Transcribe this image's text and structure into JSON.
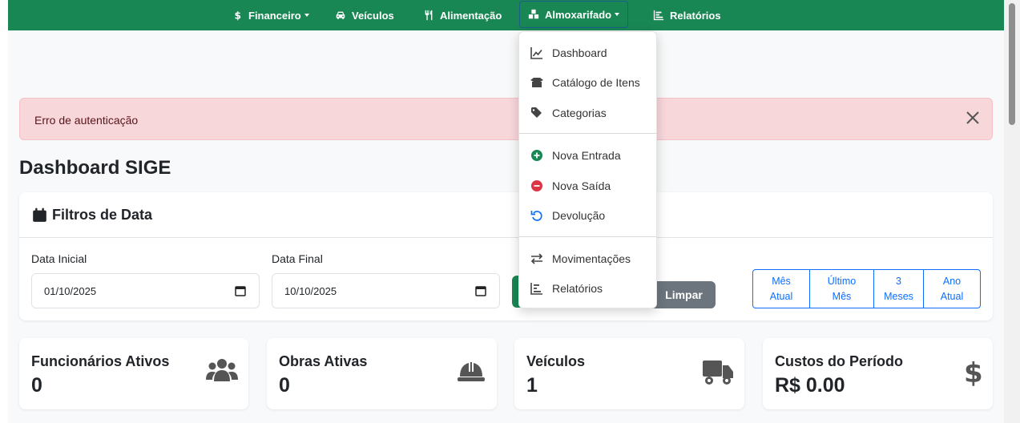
{
  "navbar": {
    "items": [
      {
        "label": "Financeiro",
        "icon": "dollar-icon",
        "dropdown": true
      },
      {
        "label": "Veículos",
        "icon": "car-icon",
        "dropdown": false
      },
      {
        "label": "Alimentação",
        "icon": "utensils-icon",
        "dropdown": false
      },
      {
        "label": "Almoxarifado",
        "icon": "boxes-icon",
        "dropdown": true
      },
      {
        "label": "Relatórios",
        "icon": "chart-icon",
        "dropdown": false
      }
    ],
    "bg_color": "#198754"
  },
  "dropdown": {
    "items": [
      {
        "label": "Dashboard",
        "icon": "line-chart-icon"
      },
      {
        "label": "Catálogo de Itens",
        "icon": "box-open-icon"
      },
      {
        "label": "Categorias",
        "icon": "tags-icon"
      },
      {
        "label": "Nova Entrada",
        "icon": "plus-circle-icon"
      },
      {
        "label": "Nova Saída",
        "icon": "minus-circle-icon"
      },
      {
        "label": "Devolução",
        "icon": "undo-icon"
      },
      {
        "label": "Movimentações",
        "icon": "exchange-icon"
      },
      {
        "label": "Relatórios",
        "icon": "chart-bar-icon"
      }
    ]
  },
  "alert": {
    "message": "Erro de autenticação"
  },
  "page": {
    "title": "Dashboard SIGE"
  },
  "filters": {
    "title": "Filtros de Data",
    "start_label": "Data Inicial",
    "start_value": "01/10/2025",
    "end_label": "Data Final",
    "end_value": "10/10/2025",
    "clear_label": "Limpar",
    "quick": [
      {
        "line1": "Mês",
        "line2": "Atual"
      },
      {
        "line1": "Último",
        "line2": "Mês"
      },
      {
        "line1": "3",
        "line2": "Meses"
      },
      {
        "line1": "Ano",
        "line2": "Atual"
      }
    ]
  },
  "stats": [
    {
      "title": "Funcionários Ativos",
      "value": "0",
      "icon": "users-icon"
    },
    {
      "title": "Obras Ativas",
      "value": "0",
      "icon": "hard-hat-icon"
    },
    {
      "title": "Veículos",
      "value": "1",
      "icon": "truck-icon"
    },
    {
      "title": "Custos do Período",
      "value": "R$ 0.00",
      "icon": "dollar-icon"
    }
  ]
}
